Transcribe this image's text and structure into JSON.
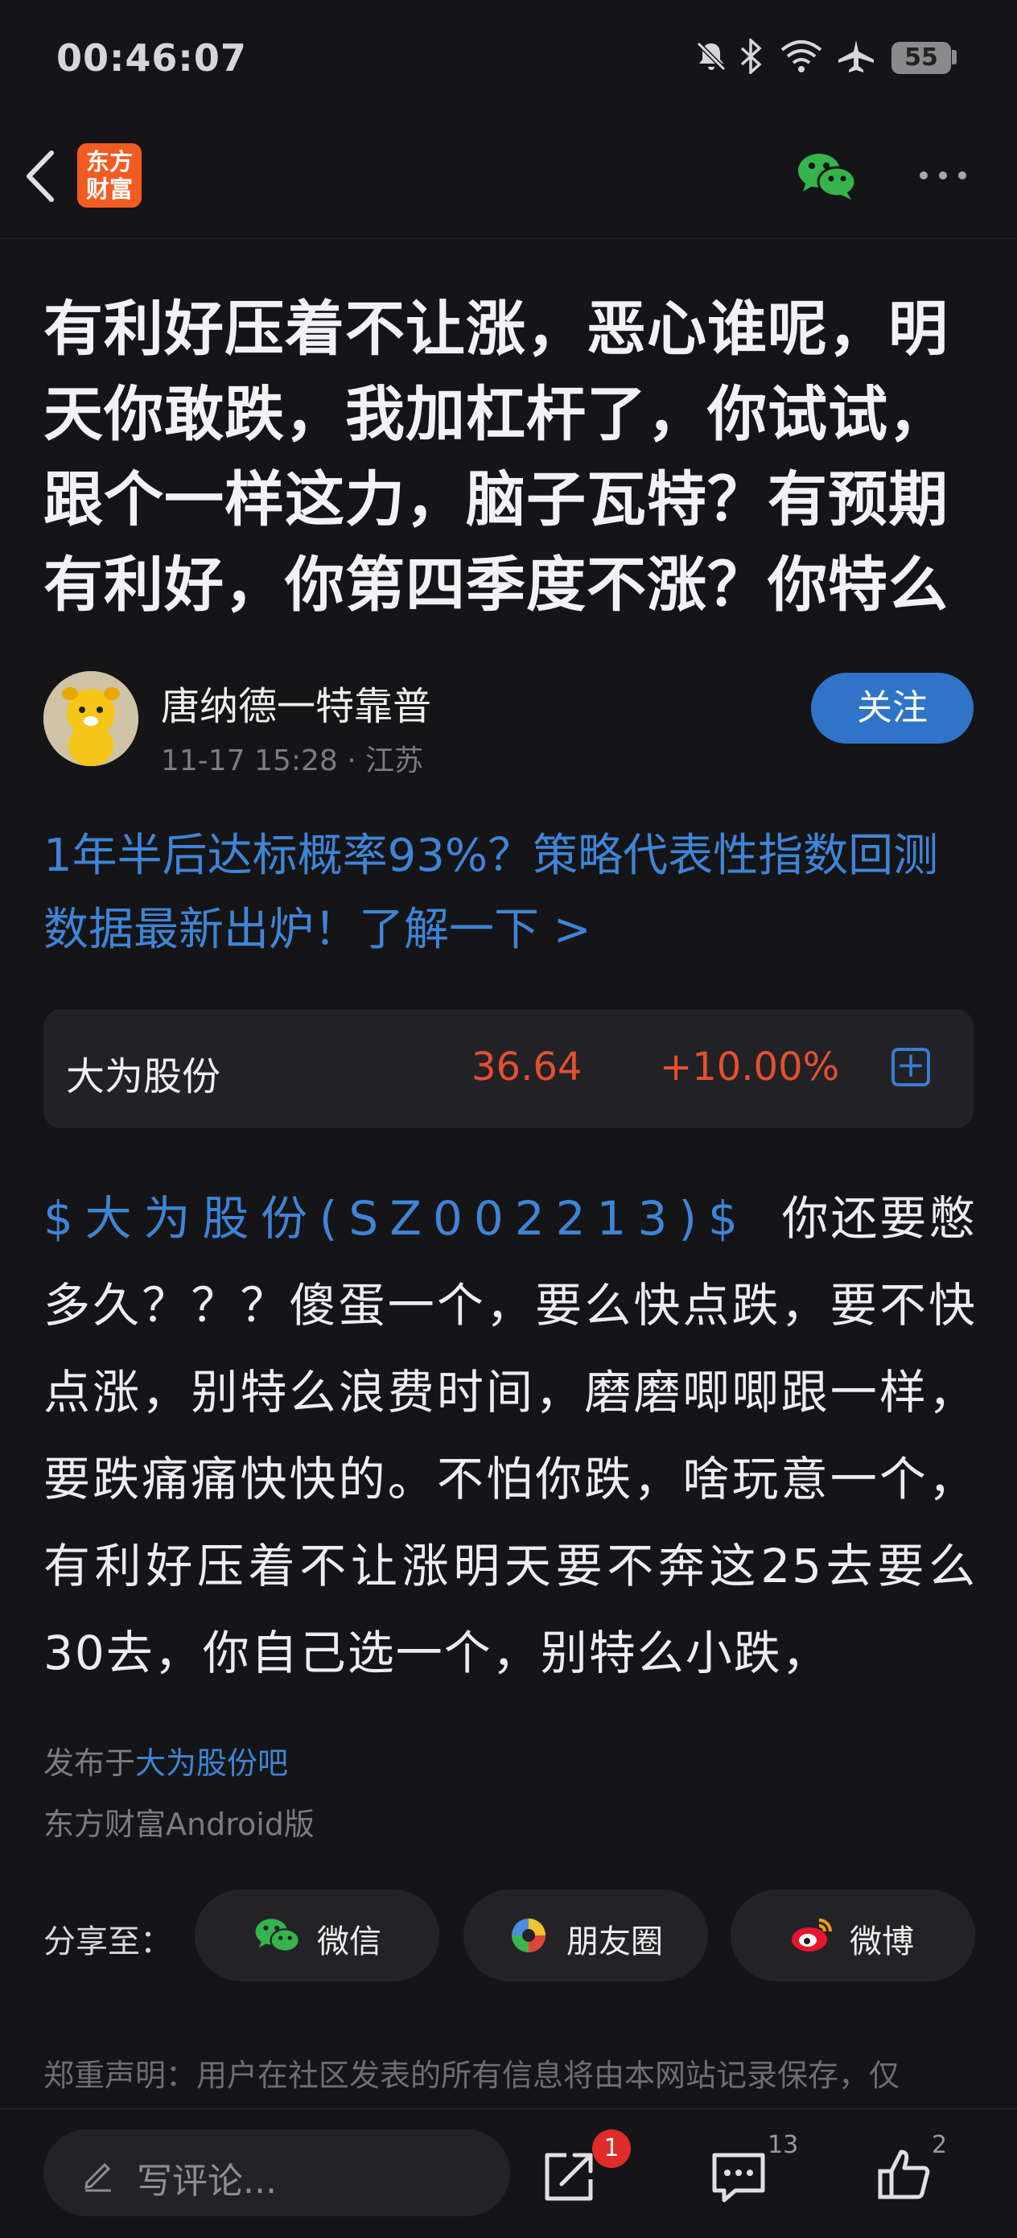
{
  "status_bar": {
    "time": "00:46:07",
    "battery": "55",
    "icons": [
      "mute-bell-icon",
      "bluetooth-icon",
      "wifi-icon",
      "airplane-icon",
      "battery-icon"
    ]
  },
  "nav": {
    "logo_line1": "东方",
    "logo_line2": "财富",
    "icons": [
      "back-icon",
      "wechat-icon",
      "more-icon"
    ]
  },
  "post": {
    "title": "有利好压着不让涨，恶心谁呢，明天你敢跌，我加杠杆了，你试试，跟个一样这力，脑子瓦特？有预期有利好，你第四季度不涨？你特么",
    "author": "唐纳德一特靠普",
    "time": "11-17 15:28",
    "location": " · 江苏",
    "follow_label": "关注",
    "promo_text": "1年半后达标概率93%？策略代表性指数回测数据最新出炉！了解一下 >",
    "stock": {
      "name": "大为股份",
      "price": "36.64",
      "change": "+10.00%",
      "add_symbol": "+"
    },
    "body_tag": "$大为股份(SZ002213)$",
    "body_text": "你还要憋多久？？？傻蛋一个，要么快点跌，要不快点涨，别特么浪费时间，磨磨唧唧跟一样，要跌痛痛快快的。不怕你跌，啥玩意一个，有利好压着不让涨明天要不奔这25去要么30去，你自己选一个，别特么小跌，",
    "published_prefix": "发布于",
    "forum": "大为股份吧",
    "client": "东方财富Android版"
  },
  "share": {
    "label": "分享至：",
    "buttons": [
      {
        "label": "微信",
        "icon": "wechat-icon"
      },
      {
        "label": "朋友圈",
        "icon": "moments-icon"
      },
      {
        "label": "微博",
        "icon": "weibo-icon"
      }
    ]
  },
  "disclaimer": "郑重声明：用户在社区发表的所有信息将由本网站记录保存，仅",
  "bottom_bar": {
    "comment_placeholder": "写评论...",
    "share_badge": "1",
    "comment_count": "13",
    "like_count": "2"
  },
  "colors": {
    "background": "#151517",
    "accent_blue": "#3f84d6",
    "follow_button": "#2f74c9",
    "stock_up": "#e4502f",
    "brand_orange": "#f25b22"
  }
}
